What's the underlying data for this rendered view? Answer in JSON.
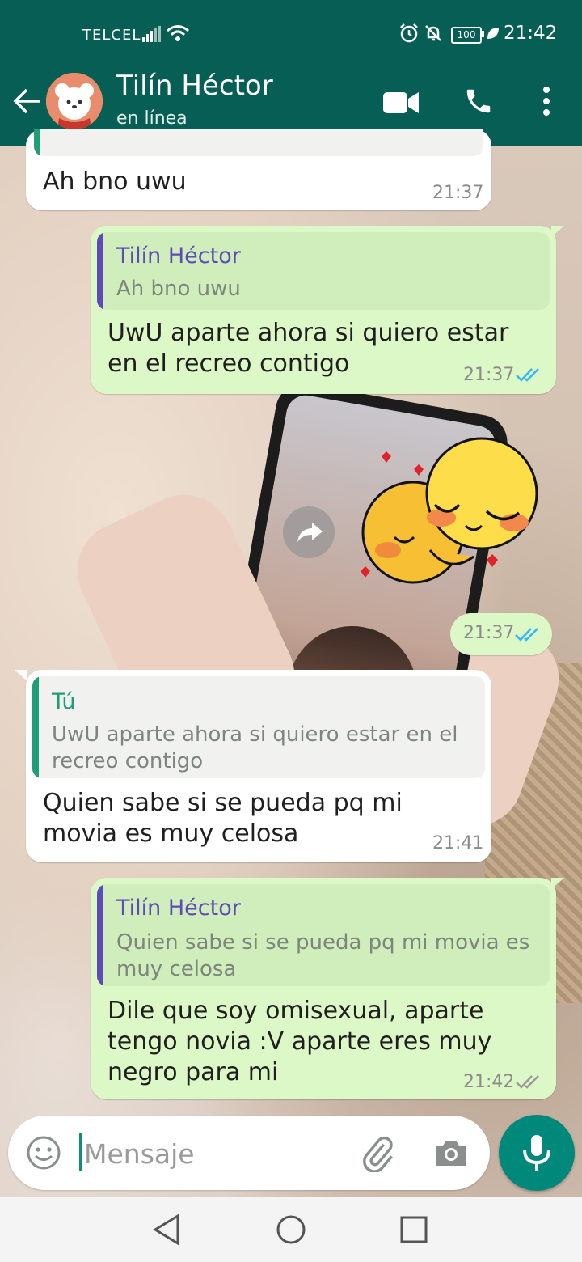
{
  "status_bar": {
    "carrier": "TELCEL",
    "battery": "100",
    "time": "21:42"
  },
  "header": {
    "title": "Tilín Héctor",
    "subtitle": "en línea"
  },
  "messages": [
    {
      "text": "Ah bno uwu",
      "time": "21:37"
    },
    {
      "quote_author": "Tilín Héctor",
      "quote_text": "Ah bno uwu",
      "text": "UwU aparte ahora si quiero estar en el recreo contigo",
      "time": "21:37"
    },
    {
      "time": "21:37"
    },
    {
      "quote_author": "Tú",
      "quote_text": "UwU aparte ahora si quiero estar en el recreo contigo",
      "text": "Quien sabe si se pueda pq mi movia es muy celosa",
      "time": "21:41"
    },
    {
      "quote_author": "Tilín Héctor",
      "quote_text": "Quien sabe si se pueda pq mi movia es muy celosa",
      "text": "Dile que soy omisexual, aparte tengo novia :V aparte eres muy negro para mi",
      "time": "21:42"
    }
  ],
  "input": {
    "placeholder": "Mensaje"
  },
  "colors": {
    "header": "#075e54",
    "outgoing_bubble": "#dcf8c6",
    "incoming_bubble": "#ffffff",
    "read_ticks": "#34b7f1",
    "quote_author_out": "#5f4ab8",
    "quote_author_in": "#1f9d77",
    "mic_button": "#00897b"
  },
  "icons": [
    "back-arrow-icon",
    "video-call-icon",
    "voice-call-icon",
    "more-vert-icon",
    "emoji-icon",
    "attach-clip-icon",
    "camera-icon",
    "mic-icon",
    "forward-icon",
    "double-check-icon",
    "alarm-icon",
    "mute-icon",
    "wifi-icon",
    "signal-icon",
    "leaf-icon"
  ]
}
